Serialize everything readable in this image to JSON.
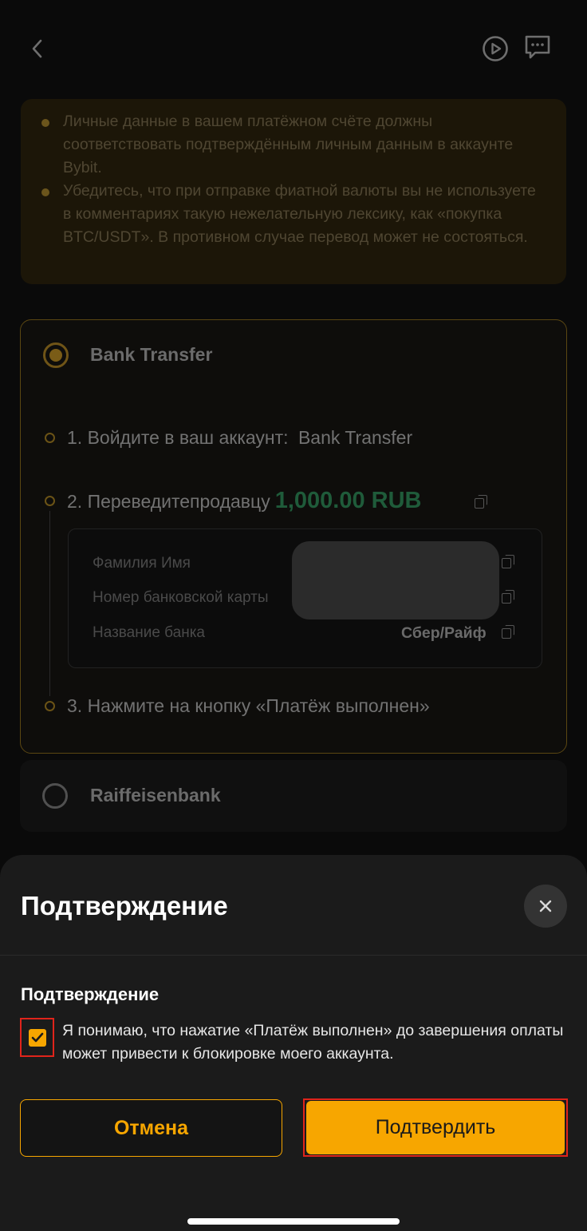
{
  "header": {
    "back_icon": "chevron-left-icon",
    "play_icon": "play-circle-icon",
    "chat_icon": "chat-icon"
  },
  "warning": {
    "items": [
      "Личные данные в вашем платёжном счёте должны соответствовать подтверждённым личным данным в аккаунте Bybit.",
      "Убедитесь, что при отправке фиатной валюты вы не используете в комментариях такую нежелательную лексику, как «покупка BTC/USDT». В противном случае перевод может не состояться."
    ]
  },
  "payment_methods": [
    {
      "name": "Bank Transfer",
      "selected": true,
      "steps": {
        "step1_prefix": "1. Войдите в ваш аккаунт:",
        "step1_value": "Bank Transfer",
        "step2_prefix": "2. Переведитепродавцу",
        "step2_amount": "1,000.00 RUB",
        "step3": "3. Нажмите на кнопку «Платёж выполнен»"
      },
      "details": [
        {
          "label": "Фамилия Имя",
          "value": ""
        },
        {
          "label": "Номер банковской карты",
          "value": ""
        },
        {
          "label": "Название банка",
          "value": "Сбер/Райф"
        }
      ]
    },
    {
      "name": "Raiffeisenbank",
      "selected": false
    }
  ],
  "sheet": {
    "title": "Подтверждение",
    "subtitle": "Подтверждение",
    "consent_text": "Я понимаю, что нажатие «Платёж выполнен» до завершения оплаты может привести к блокировке моего аккаунта.",
    "checkbox_checked": true,
    "cancel_label": "Отмена",
    "confirm_label": "Подтвердить"
  },
  "colors": {
    "accent": "#f7a600",
    "highlight_box": "#e0241b",
    "amount_green": "#1f5b3a"
  }
}
